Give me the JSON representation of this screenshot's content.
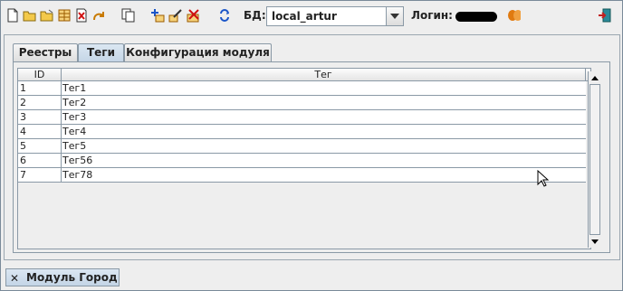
{
  "toolbar": {
    "icons": [
      "new-file-icon",
      "open-folder-icon",
      "open-folder-alt-icon",
      "table-icon",
      "delete-icon",
      "undo-icon",
      "copy-icon",
      "add-icon",
      "edit-icon",
      "cancel-icon",
      "refresh-icon"
    ],
    "db_label": "БД:",
    "db_value": "local_artur",
    "login_label": "Логин:",
    "exit_icon": "exit-icon"
  },
  "tabs": [
    {
      "label": "Реестры",
      "active": false
    },
    {
      "label": "Теги",
      "active": true
    },
    {
      "label": "Конфигурация модуля",
      "active": false
    }
  ],
  "table": {
    "columns": [
      "ID",
      "Тег"
    ],
    "rows": [
      {
        "id": "1",
        "tag": "Тег1"
      },
      {
        "id": "2",
        "tag": "Тег2"
      },
      {
        "id": "3",
        "tag": "Тег3"
      },
      {
        "id": "4",
        "tag": "Тег4"
      },
      {
        "id": "5",
        "tag": "Тег5"
      },
      {
        "id": "6",
        "tag": "Тег56"
      },
      {
        "id": "7",
        "tag": "Тег78"
      }
    ]
  },
  "bottom_tab": {
    "label": "Модуль Город",
    "close": "✕"
  }
}
